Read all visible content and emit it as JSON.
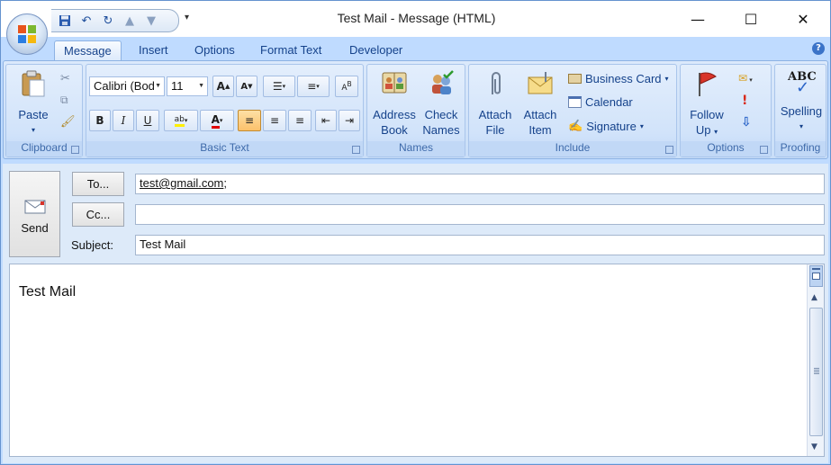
{
  "window": {
    "title": "Test Mail - Message (HTML)",
    "minimize_glyph": "—",
    "maximize_glyph": "☐",
    "close_glyph": "✕"
  },
  "tabs": [
    "Message",
    "Insert",
    "Options",
    "Format Text",
    "Developer"
  ],
  "ribbon": {
    "clipboard": {
      "label": "Clipboard",
      "paste": "Paste"
    },
    "basic_text": {
      "label": "Basic Text",
      "font": "Calibri (Bod",
      "size": "11"
    },
    "names": {
      "label": "Names",
      "address_book_l1": "Address",
      "address_book_l2": "Book",
      "check_names_l1": "Check",
      "check_names_l2": "Names"
    },
    "include": {
      "label": "Include",
      "attach_file_l1": "Attach",
      "attach_file_l2": "File",
      "attach_item_l1": "Attach",
      "attach_item_l2": "Item",
      "business_card": "Business Card",
      "calendar": "Calendar",
      "signature": "Signature"
    },
    "options": {
      "label": "Options",
      "follow_up_l1": "Follow",
      "follow_up_l2": "Up"
    },
    "proofing": {
      "label": "Proofing",
      "spelling": "Spelling",
      "abc": "ABC"
    }
  },
  "compose": {
    "send": "Send",
    "to_button": "To...",
    "cc_button": "Cc...",
    "subject_label": "Subject:",
    "to_value": "test@gmail.com",
    "to_separator": ";",
    "cc_value": "",
    "subject_value": "Test Mail",
    "body_text": "Test Mail"
  },
  "colors": {
    "ribbon_bg": "#bfdbff",
    "accent": "#15428b",
    "active_button": "#fbc16b"
  }
}
